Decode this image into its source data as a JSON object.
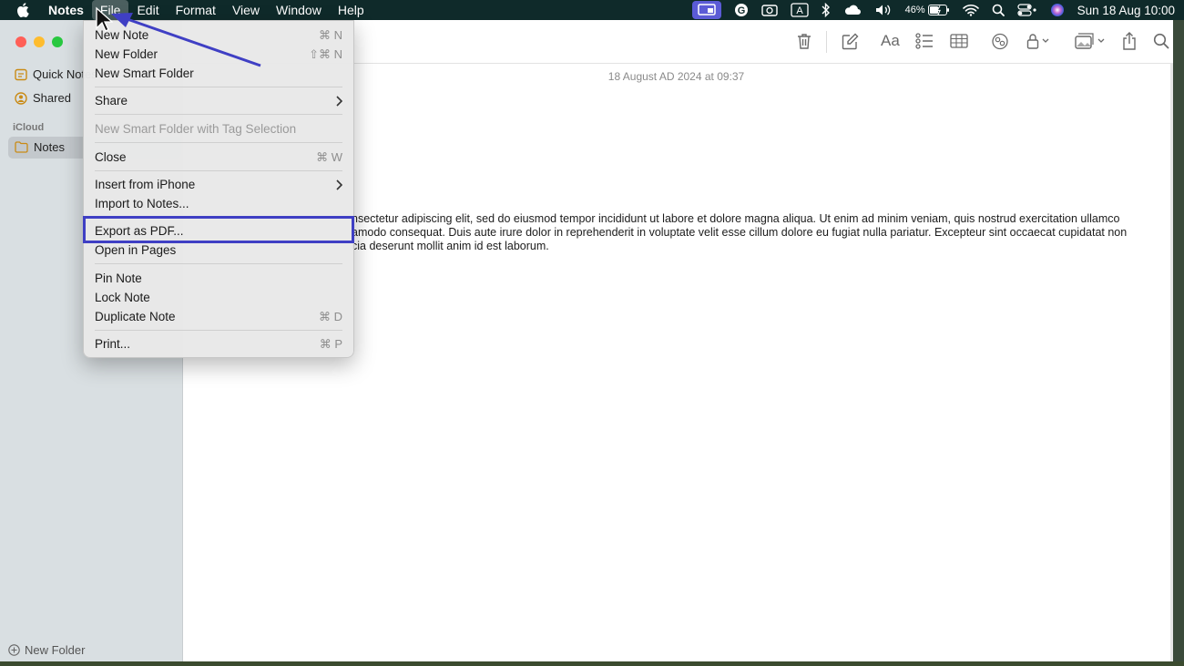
{
  "menubar": {
    "app_name": "Notes",
    "items": [
      "File",
      "Edit",
      "Format",
      "View",
      "Window",
      "Help"
    ],
    "battery": "46%",
    "datetime": "Sun 18 Aug  10:00"
  },
  "sidebar": {
    "items": [
      {
        "label": "Quick Notes",
        "icon": "quick-notes-icon"
      },
      {
        "label": "Shared",
        "icon": "shared-icon"
      }
    ],
    "section": "iCloud",
    "selected": {
      "label": "Notes",
      "icon": "folder-icon"
    },
    "new_folder": "New Folder"
  },
  "note": {
    "date": "18 August AD 2024 at 09:37",
    "body": "nsectetur adipiscing elit, sed do eiusmod tempor incididunt ut labore et dolore magna aliqua. Ut enim ad minim veniam, quis nostrud exercitation ullamco amodo consequat. Duis aute irure dolor in reprehenderit in voluptate velit esse cillum dolore eu fugiat nulla pariatur. Excepteur sint occaecat cupidatat non cia deserunt mollit anim id est laborum."
  },
  "file_menu": {
    "new_note": {
      "label": "New Note",
      "shortcut": "⌘ N"
    },
    "new_folder": {
      "label": "New Folder",
      "shortcut": "⇧⌘ N"
    },
    "new_smart_folder": {
      "label": "New Smart Folder"
    },
    "share": {
      "label": "Share"
    },
    "new_smart_folder_tag": {
      "label": "New Smart Folder with Tag Selection"
    },
    "close": {
      "label": "Close",
      "shortcut": "⌘ W"
    },
    "insert_iphone": {
      "label": "Insert from iPhone"
    },
    "import": {
      "label": "Import to Notes..."
    },
    "export_pdf": {
      "label": "Export as PDF..."
    },
    "open_pages": {
      "label": "Open in Pages"
    },
    "pin": {
      "label": "Pin Note"
    },
    "lock": {
      "label": "Lock Note"
    },
    "duplicate": {
      "label": "Duplicate Note",
      "shortcut": "⌘ D"
    },
    "print": {
      "label": "Print...",
      "shortcut": "⌘ P"
    }
  },
  "colors": {
    "highlight": "#3f3fc4",
    "arrow": "#3f3fc4"
  }
}
